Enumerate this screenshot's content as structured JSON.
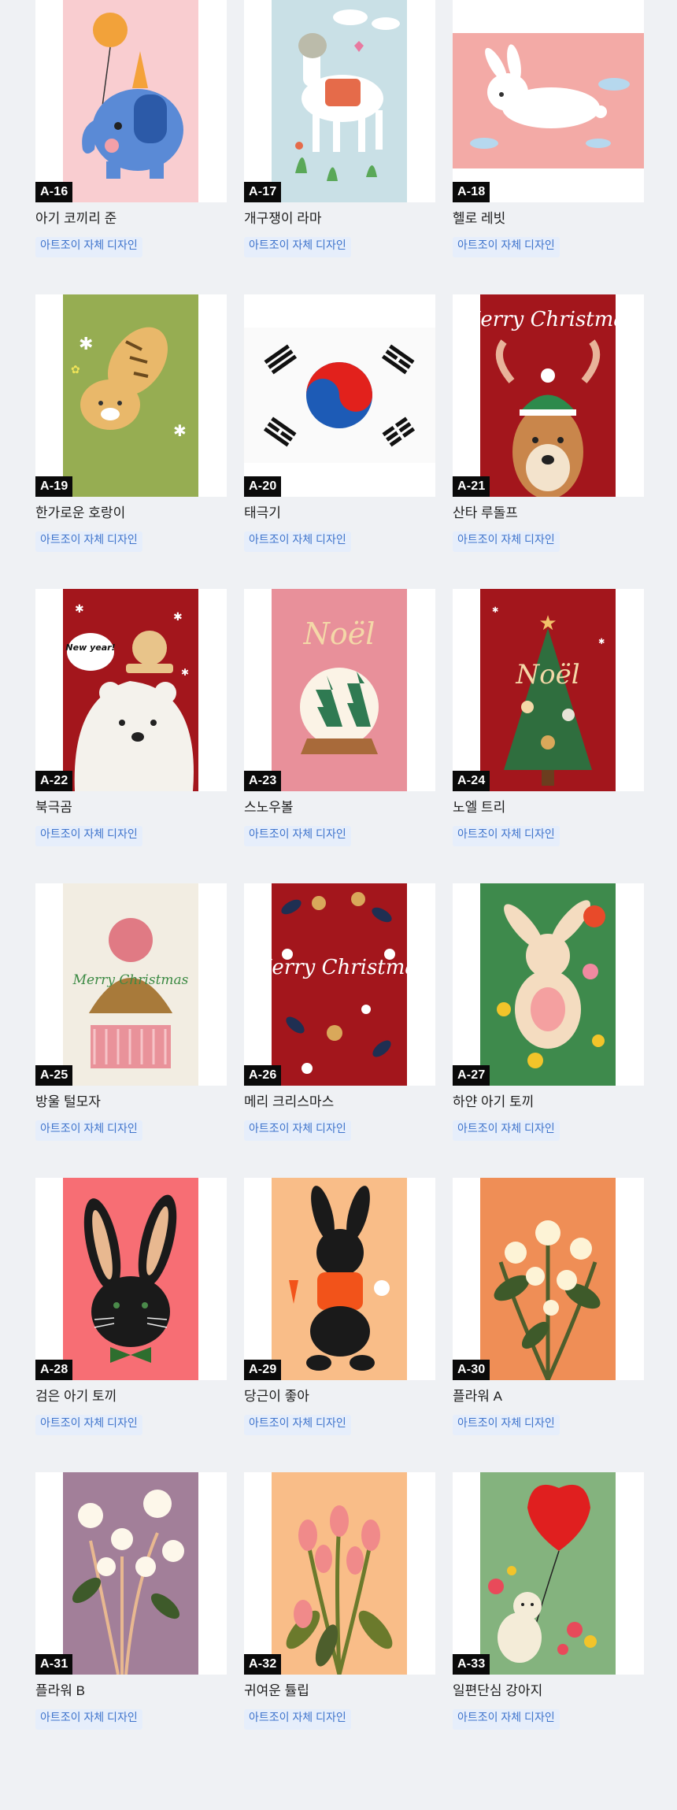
{
  "products": [
    {
      "code": "A-16",
      "title": "아기 코끼리 준",
      "tag": "아트조이 자체 디자인"
    },
    {
      "code": "A-17",
      "title": "개구쟁이 라마",
      "tag": "아트조이 자체 디자인"
    },
    {
      "code": "A-18",
      "title": "헬로 레빗",
      "tag": "아트조이 자체 디자인"
    },
    {
      "code": "A-19",
      "title": "한가로운 호랑이",
      "tag": "아트조이 자체 디자인"
    },
    {
      "code": "A-20",
      "title": "태극기",
      "tag": "아트조이 자체 디자인"
    },
    {
      "code": "A-21",
      "title": "산타 루돌프",
      "tag": "아트조이 자체 디자인"
    },
    {
      "code": "A-22",
      "title": "북극곰",
      "tag": "아트조이 자체 디자인"
    },
    {
      "code": "A-23",
      "title": "스노우볼",
      "tag": "아트조이 자체 디자인"
    },
    {
      "code": "A-24",
      "title": "노엘 트리",
      "tag": "아트조이 자체 디자인"
    },
    {
      "code": "A-25",
      "title": "방울 털모자",
      "tag": "아트조이 자체 디자인"
    },
    {
      "code": "A-26",
      "title": "메리 크리스마스",
      "tag": "아트조이 자체 디자인"
    },
    {
      "code": "A-27",
      "title": "하얀 아기 토끼",
      "tag": "아트조이 자체 디자인"
    },
    {
      "code": "A-28",
      "title": "검은 아기 토끼",
      "tag": "아트조이 자체 디자인"
    },
    {
      "code": "A-29",
      "title": "당근이 좋아",
      "tag": "아트조이 자체 디자인"
    },
    {
      "code": "A-30",
      "title": "플라워 A",
      "tag": "아트조이 자체 디자인"
    },
    {
      "code": "A-31",
      "title": "플라워 B",
      "tag": "아트조이 자체 디자인"
    },
    {
      "code": "A-32",
      "title": "귀여운 튤립",
      "tag": "아트조이 자체 디자인"
    },
    {
      "code": "A-33",
      "title": "일편단심 강아지",
      "tag": "아트조이 자체 디자인"
    }
  ],
  "artwork_text": {
    "merry_christmas_a21": "Merry Christmas",
    "new_year": "New year!",
    "noel_a23": "Noël",
    "noel_a24": "Noël",
    "merry_christmas_a25": "Merry Christmas",
    "merry_christmas_a26": "Merry Christmas"
  }
}
